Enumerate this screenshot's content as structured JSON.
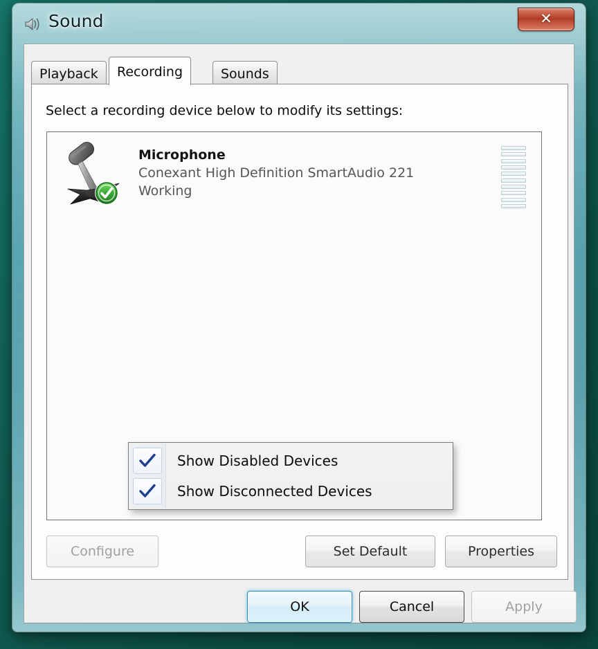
{
  "window": {
    "title": "Sound",
    "icon": "speaker-icon",
    "close_label": "✕"
  },
  "tabs": [
    {
      "id": "playback",
      "label": "Playback",
      "active": false
    },
    {
      "id": "recording",
      "label": "Recording",
      "active": true
    },
    {
      "id": "sounds",
      "label": "Sounds",
      "active": false
    }
  ],
  "panel": {
    "instruction": "Select a recording device below to modify its settings:"
  },
  "devices": [
    {
      "name": "Microphone",
      "description": "Conexant High Definition SmartAudio 221",
      "status": "Working",
      "icon": "microphone-icon",
      "badge": "green-check-badge",
      "level_segments": 10,
      "level_value": 0
    }
  ],
  "context_menu": {
    "visible": true,
    "items": [
      {
        "label": "Show Disabled Devices",
        "checked": true
      },
      {
        "label": "Show Disconnected Devices",
        "checked": true
      }
    ]
  },
  "device_buttons": [
    {
      "id": "configure",
      "label": "Configure",
      "enabled": false
    },
    {
      "id": "set-default",
      "label": "Set Default",
      "enabled": true
    },
    {
      "id": "properties",
      "label": "Properties",
      "enabled": true
    }
  ],
  "dialog_buttons": [
    {
      "id": "ok",
      "label": "OK",
      "enabled": true,
      "style": "default"
    },
    {
      "id": "cancel",
      "label": "Cancel",
      "enabled": true,
      "style": "cancel"
    },
    {
      "id": "apply",
      "label": "Apply",
      "enabled": false,
      "style": "normal"
    }
  ],
  "colors": {
    "frame_glass": "#6cb4c4",
    "desktop": "#0f5a4f",
    "close_red": "#ad3a23",
    "accent_blue": "#2c8fbf",
    "check_blue": "#1d3d8f",
    "status_green": "#3fa93f"
  }
}
